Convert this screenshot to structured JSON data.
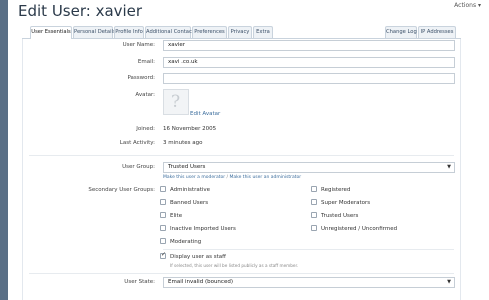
{
  "page": {
    "title": "Edit User: xavier",
    "actions_label": "Actions ▾"
  },
  "tabs": [
    {
      "label": "User Essentials",
      "active": true
    },
    {
      "label": "Personal Details"
    },
    {
      "label": "Profile Info"
    },
    {
      "label": "Additional Contact"
    },
    {
      "label": "Preferences"
    },
    {
      "label": "Privacy"
    },
    {
      "label": "Extra"
    },
    {
      "label": "Change Log"
    },
    {
      "label": "IP Addresses"
    }
  ],
  "form": {
    "username_label": "User Name:",
    "username_value": "xavier",
    "email_label": "Email:",
    "email_value": "xavi              .co.uk",
    "password_label": "Password:",
    "password_value": "",
    "avatar_label": "Avatar:",
    "edit_avatar": "Edit Avatar",
    "joined_label": "Joined:",
    "joined_value": "16 November 2005",
    "last_activity_label": "Last Activity:",
    "last_activity_value": "3 minutes ago",
    "user_group_label": "User Group:",
    "user_group_value": "Trusted Users",
    "moderator_link": "Make this user a moderator",
    "link_sep": "/",
    "admin_link": "Make this user an administrator",
    "secondary_label": "Secondary User Groups:",
    "secondary_left": [
      {
        "label": "Administrative",
        "checked": false
      },
      {
        "label": "Banned Users",
        "checked": false
      },
      {
        "label": "Elite",
        "checked": false
      },
      {
        "label": "Inactive Imported Users",
        "checked": false
      },
      {
        "label": "Moderating",
        "checked": false
      }
    ],
    "secondary_right": [
      {
        "label": "Registered",
        "checked": false
      },
      {
        "label": "Super Moderators",
        "checked": false
      },
      {
        "label": "Trusted Users",
        "checked": false
      },
      {
        "label": "Unregistered / Unconfirmed",
        "checked": false
      }
    ],
    "display_staff_label": "Display user as staff",
    "display_staff_checked": true,
    "display_staff_hint": "If selected, this user will be listed publicly as a staff member.",
    "user_state_label": "User State:",
    "user_state_value": "Email invalid (bounced)"
  },
  "colors": {
    "accent": "#3a6c9c",
    "title": "#2b3a4a",
    "sidebar": "#5a6f86"
  }
}
